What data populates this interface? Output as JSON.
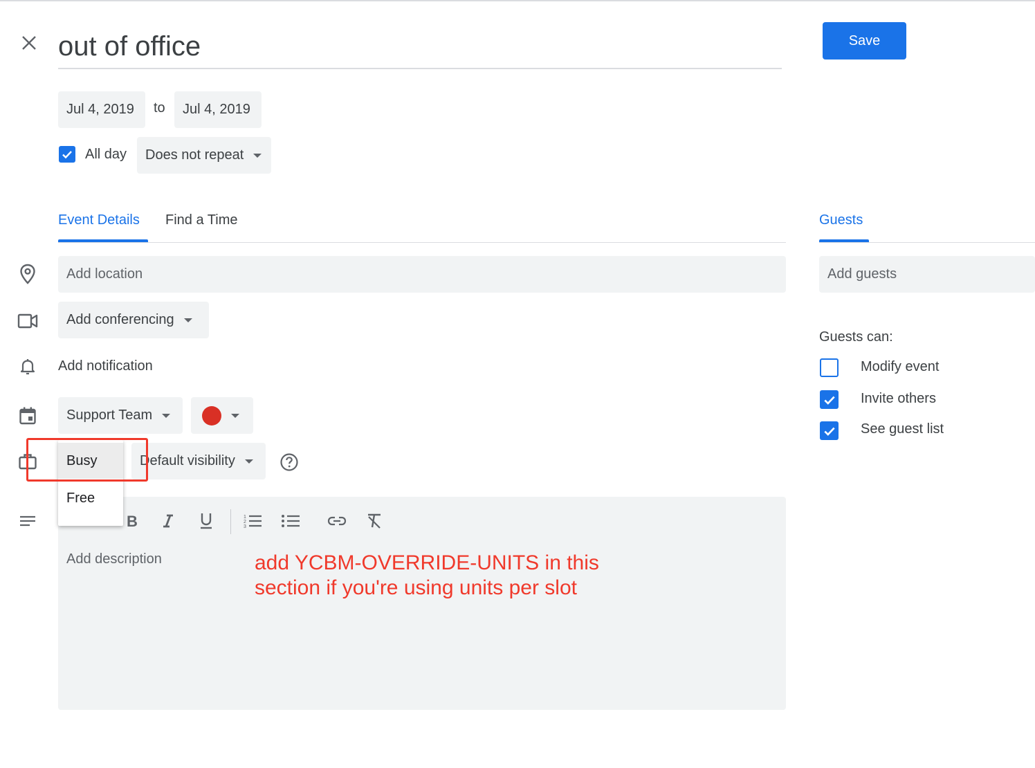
{
  "header": {
    "title_value": "out of office",
    "save_label": "Save"
  },
  "dates": {
    "start": "Jul 4, 2019",
    "to_label": "to",
    "end": "Jul 4, 2019",
    "all_day_label": "All day",
    "repeat_value": "Does not repeat"
  },
  "tabs": {
    "event_details": "Event Details",
    "find_time": "Find a Time",
    "guests": "Guests"
  },
  "details": {
    "location_placeholder": "Add location",
    "conferencing_label": "Add conferencing",
    "notification_label": "Add notification",
    "calendar_value": "Support Team",
    "event_color": "#d93025",
    "visibility_value": "Default visibility"
  },
  "availability_menu": {
    "options": [
      "Busy",
      "Free"
    ],
    "selected": "Busy"
  },
  "description": {
    "placeholder": "Add description"
  },
  "annotation": {
    "line1": "add YCBM-OVERRIDE-UNITS in this",
    "line2": "section if you're using units per slot"
  },
  "guests": {
    "placeholder": "Add guests",
    "can_label": "Guests can:",
    "permissions": [
      {
        "label": "Modify event",
        "checked": false
      },
      {
        "label": "Invite others",
        "checked": true
      },
      {
        "label": "See guest list",
        "checked": true
      }
    ]
  },
  "colors": {
    "accent": "#1a73e8",
    "annotation": "#f0392b",
    "field_bg": "#f1f3f4"
  }
}
